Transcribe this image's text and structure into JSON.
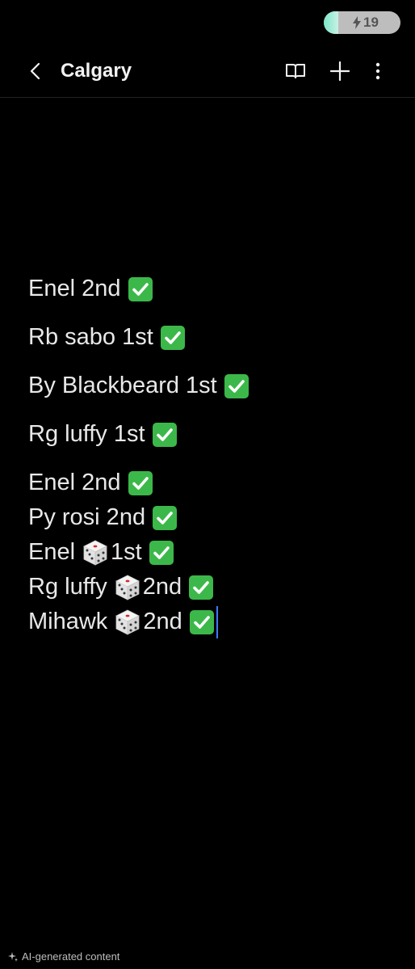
{
  "status": {
    "battery_level": "19"
  },
  "header": {
    "title": "Calgary"
  },
  "note": {
    "lines": [
      {
        "before": "Enel 2nd",
        "dice": false,
        "after": ""
      },
      {
        "before": "Rb sabo 1st",
        "dice": false,
        "after": ""
      },
      {
        "before": "By Blackbeard 1st",
        "dice": false,
        "after": ""
      },
      {
        "before": "Rg luffy 1st",
        "dice": false,
        "after": ""
      },
      {
        "before": "Enel 2nd",
        "dice": false,
        "after": ""
      },
      {
        "before": "Py rosi 2nd",
        "dice": false,
        "after": ""
      },
      {
        "before": "Enel",
        "dice": true,
        "after": "1st"
      },
      {
        "before": "Rg luffy",
        "dice": true,
        "after": "2nd"
      },
      {
        "before": "Mihawk",
        "dice": true,
        "after": "2nd"
      }
    ]
  },
  "footer": {
    "ai_label": "AI-generated content"
  },
  "colors": {
    "background": "#000000",
    "check_green": "#3cb84a",
    "cursor_blue": "#3d7bff"
  }
}
